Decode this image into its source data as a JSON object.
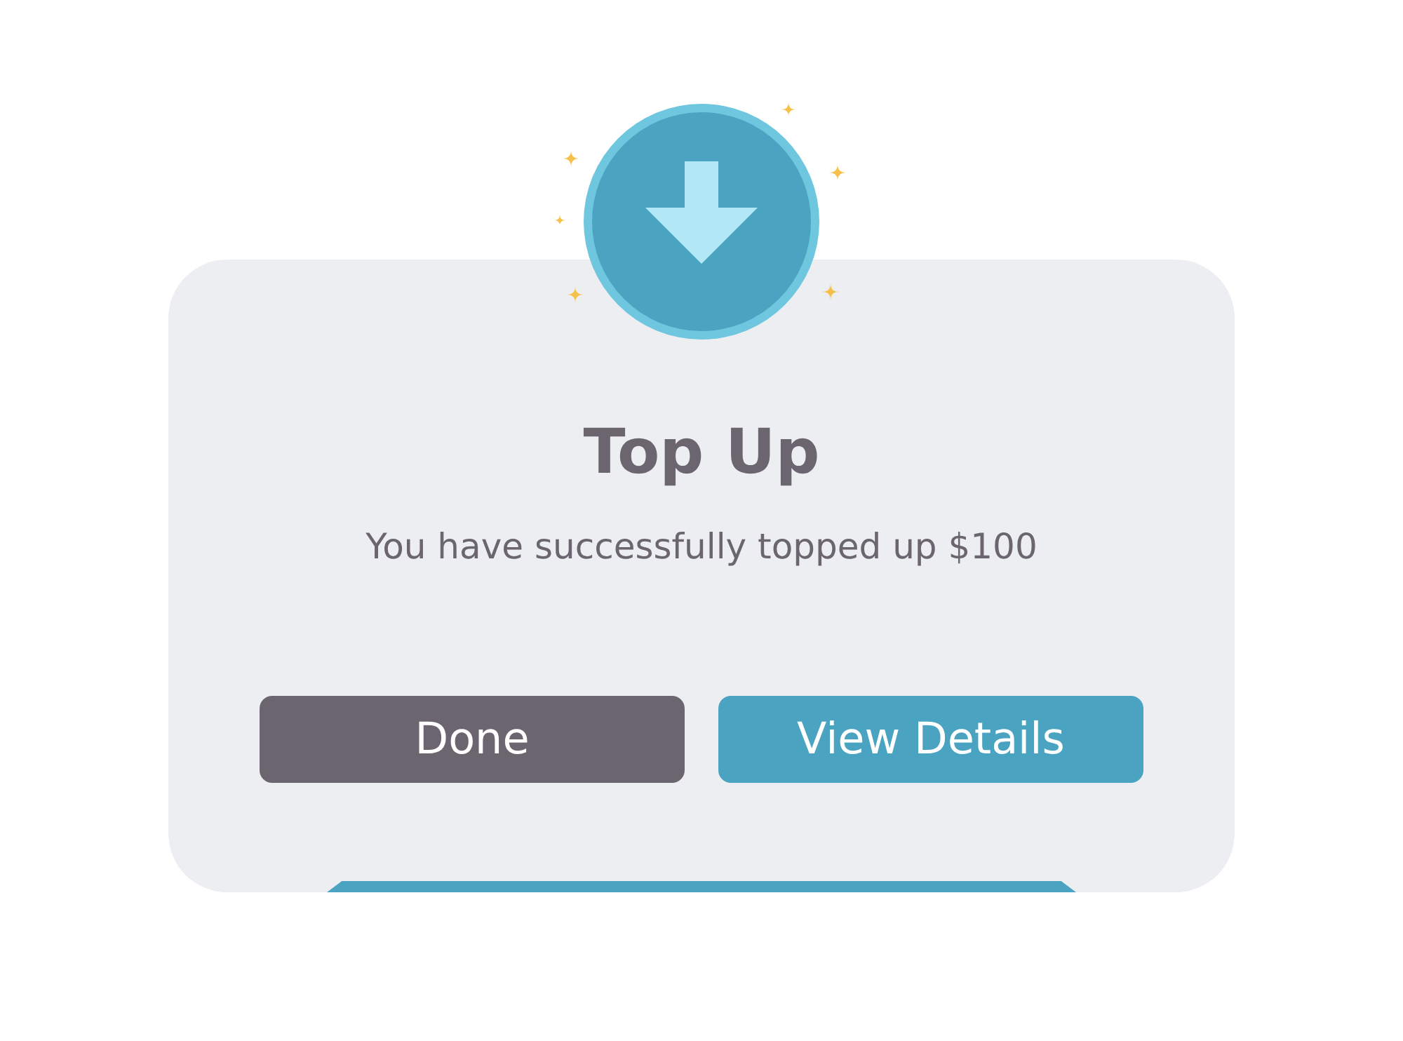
{
  "dialog": {
    "title": "Top Up",
    "message": "You have successfully topped up $100",
    "buttons": [
      {
        "label": "Done",
        "kind": "secondary"
      },
      {
        "label": "View Details",
        "kind": "primary"
      }
    ]
  }
}
